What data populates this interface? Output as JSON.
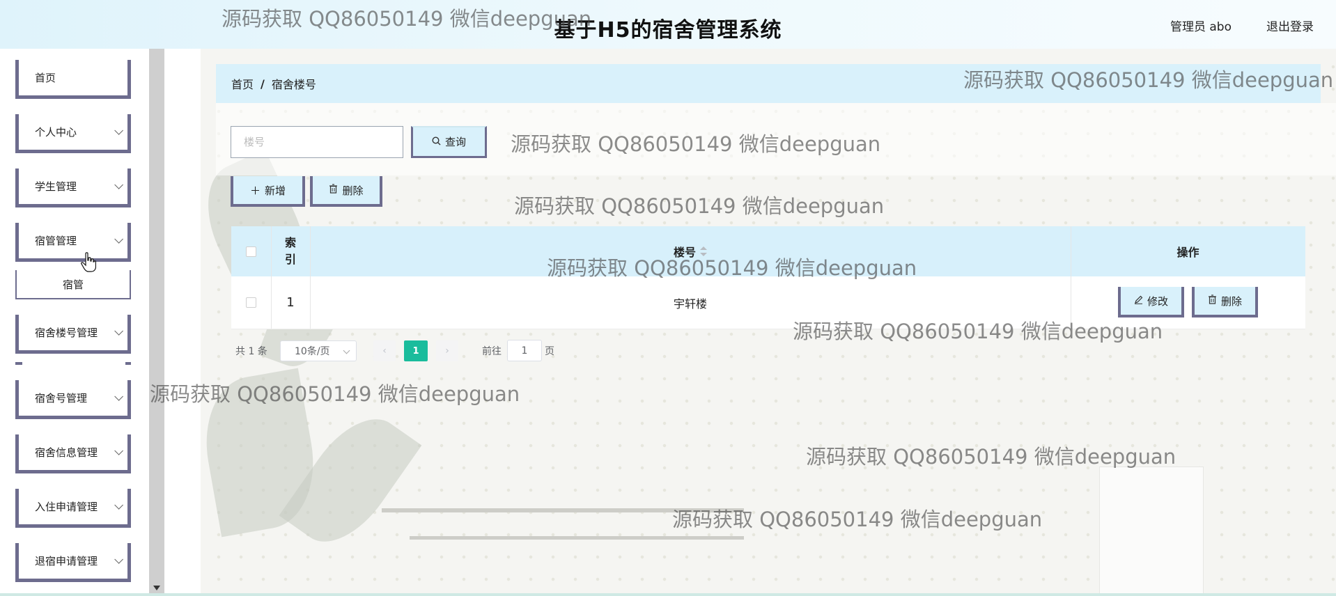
{
  "header": {
    "title": "基于H5的宿舍管理系统",
    "user_label": "管理员 abo",
    "logout_label": "退出登录"
  },
  "sidebar": {
    "items": [
      {
        "label": "首页",
        "has_arrow": false
      },
      {
        "label": "个人中心",
        "has_arrow": true
      },
      {
        "label": "学生管理",
        "has_arrow": true
      },
      {
        "label": "宿管管理",
        "has_arrow": true,
        "expanded": true
      },
      {
        "label": "宿舍楼号管理",
        "has_arrow": true
      },
      {
        "label": "宿舍号管理",
        "has_arrow": true
      },
      {
        "label": "宿舍信息管理",
        "has_arrow": true
      },
      {
        "label": "入住申请管理",
        "has_arrow": true
      },
      {
        "label": "退宿申请管理",
        "has_arrow": true
      }
    ],
    "submenu": {
      "parent": "宿管管理",
      "items": [
        {
          "label": "宿管"
        }
      ]
    }
  },
  "breadcrumb": {
    "home": "首页",
    "separator": "/",
    "current": "宿舍楼号"
  },
  "search": {
    "placeholder": "楼号",
    "value": "",
    "query_label": "查询"
  },
  "actions": {
    "add_label": "新增",
    "delete_label": "删除"
  },
  "table": {
    "columns": {
      "index": "索引",
      "building": "楼号",
      "operation": "操作"
    },
    "rows": [
      {
        "index": "1",
        "building": "宇轩楼",
        "edit_label": "修改",
        "delete_label": "删除"
      }
    ]
  },
  "pagination": {
    "total_text": "共 1 条",
    "page_size": "10条/页",
    "prev": "‹",
    "next": "›",
    "current_page": "1",
    "goto_label": "前往",
    "goto_value": "1",
    "page_unit": "页"
  },
  "watermark": {
    "text": "源码获取 QQ86050149 微信deepguan"
  },
  "colors": {
    "header_bg": "#dff3fb",
    "menu_border": "#6d6c8e",
    "table_header_bg": "#d7f0fb",
    "active_page": "#1abc9c"
  },
  "icons": [
    "search-icon",
    "plus-icon",
    "trash-icon",
    "edit-icon",
    "chevron-down-icon",
    "hand-cursor-icon"
  ]
}
